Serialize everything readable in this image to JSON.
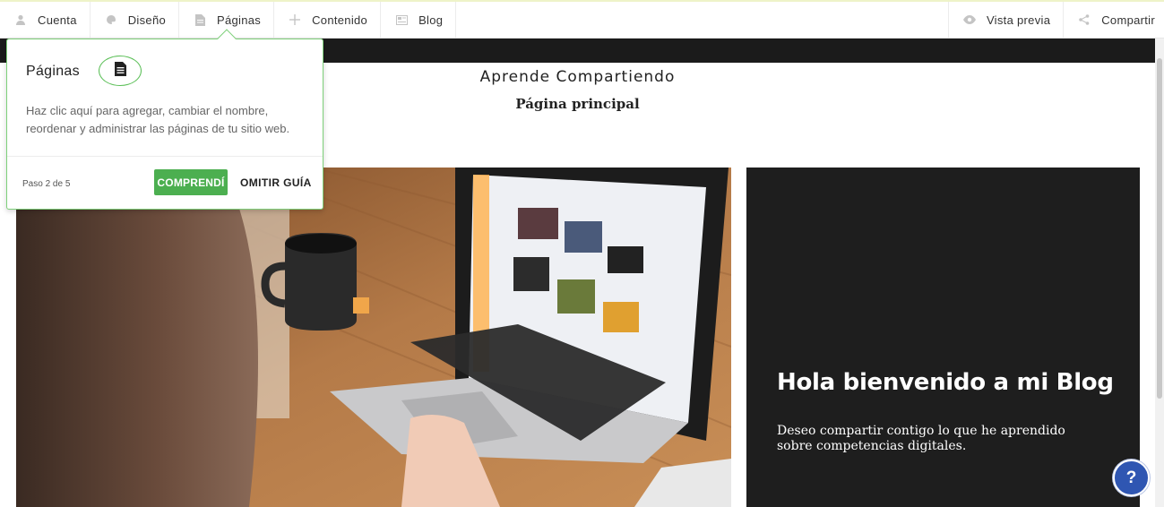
{
  "nav": {
    "left": [
      {
        "label": "Cuenta",
        "icon": "user-icon"
      },
      {
        "label": "Diseño",
        "icon": "palette-icon"
      },
      {
        "label": "Páginas",
        "icon": "page-icon"
      },
      {
        "label": "Contenido",
        "icon": "plus-icon"
      },
      {
        "label": "Blog",
        "icon": "blog-icon"
      }
    ],
    "right": [
      {
        "label": "Vista previa",
        "icon": "eye-icon"
      },
      {
        "label": "Compartir",
        "icon": "share-icon"
      }
    ]
  },
  "site": {
    "title": "Aprende Compartiendo",
    "page": "Página principal"
  },
  "hero": {
    "heading": "Hola bienvenido a mi Blog",
    "text": "Deseo compartir contigo lo que he aprendido sobre competencias digitales."
  },
  "tooltip": {
    "title": "Páginas",
    "body": "Haz clic aquí para agregar, cambiar el nombre, reordenar y administrar las páginas de tu sitio web.",
    "step": "Paso 2 de 5",
    "ok": "COMPRENDÍ",
    "skip": "OMITIR GUÍA"
  },
  "help": {
    "label": "?"
  },
  "colors": {
    "accent": "#4caf50",
    "dark": "#1e1e1e",
    "help": "#2f56b2"
  }
}
